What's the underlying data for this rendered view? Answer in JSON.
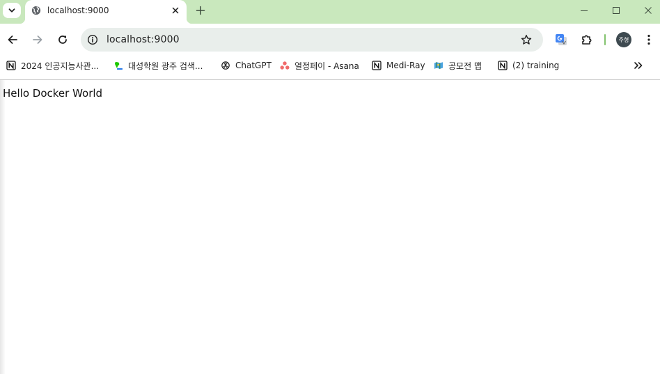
{
  "colors": {
    "tabstrip_bg": "#c9e8bd",
    "omnibox_bg": "#e9eeeb",
    "accent": "#83c36e",
    "avatar_bg": "#3e4a50"
  },
  "tabstrip": {
    "search_tabs_icon": "chevron-down-icon",
    "tab": {
      "title": "localhost:9000",
      "favicon": "globe-icon"
    },
    "new_tab_icon": "plus-icon"
  },
  "window_controls": [
    "minimize-icon",
    "maximize-icon",
    "close-icon"
  ],
  "toolbar": {
    "back_icon": "arrow-left-icon",
    "forward_icon": "arrow-right-icon",
    "reload_icon": "reload-icon",
    "omnibox": {
      "site_info_icon": "info-icon",
      "url": "localhost:9000",
      "bookmark_icon": "star-icon"
    },
    "translate_icon": "translate-icon",
    "extensions_icon": "puzzle-icon",
    "profile": {
      "avatar_text": "주형"
    },
    "menu_icon": "more-vert-icon"
  },
  "bookmarks": {
    "items": [
      {
        "label": "2024 인공지능사관...",
        "icon": "notion-icon"
      },
      {
        "label": "대성학원 광주 검색...",
        "icon": "maps-icon"
      },
      {
        "label": "ChatGPT",
        "icon": "openai-icon"
      },
      {
        "label": "열정페이 - Asana",
        "icon": "asana-icon"
      },
      {
        "label": "Medi-Ray",
        "icon": "notion-icon"
      },
      {
        "label": "공모전 맵",
        "icon": "map-icon"
      },
      {
        "label": "(2) training",
        "icon": "notion-icon"
      }
    ],
    "overflow_icon": "chevrons-right-icon"
  },
  "page": {
    "body_text": "Hello Docker World"
  }
}
